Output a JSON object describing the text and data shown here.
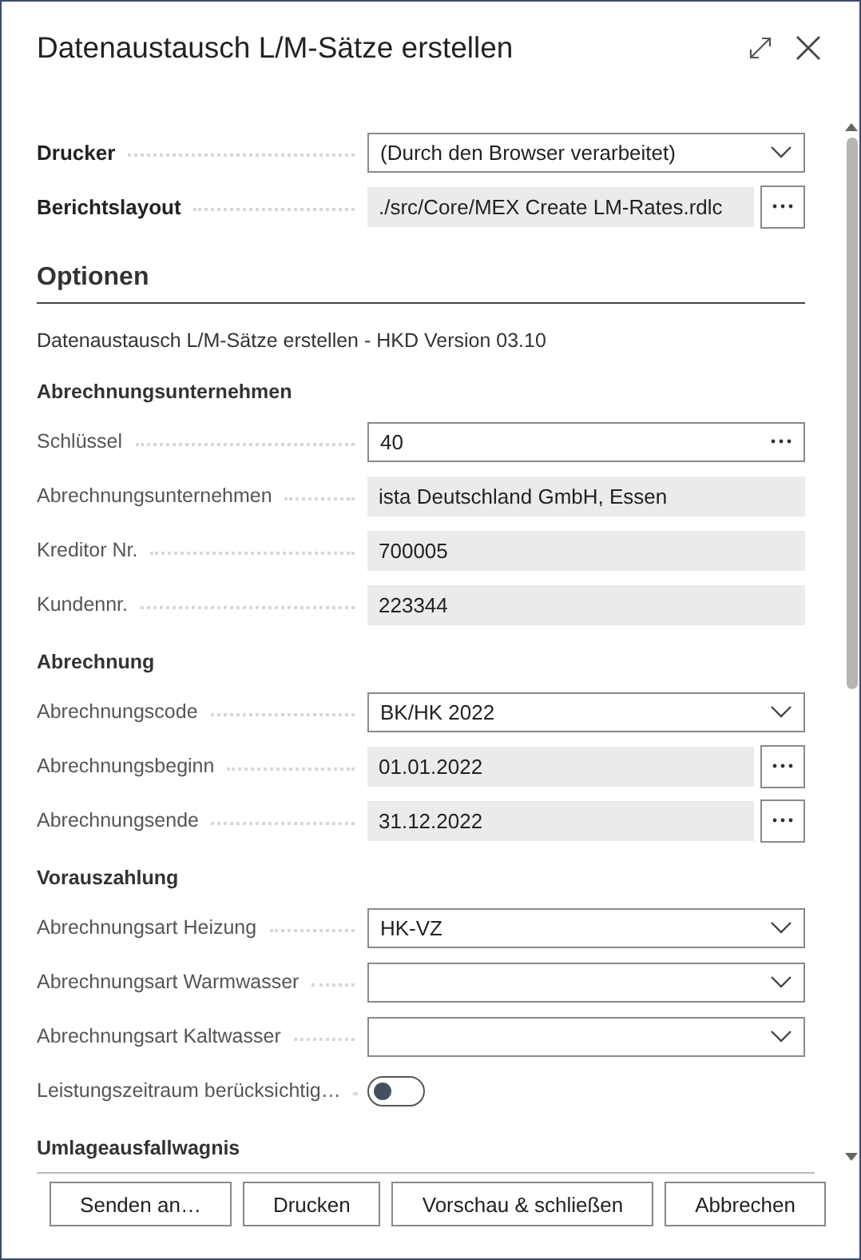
{
  "dialog": {
    "title": "Datenaustausch L/M-Sätze erstellen"
  },
  "report": {
    "fields": [
      {
        "label": "Drucker",
        "kind": "select",
        "value": "(Durch den Browser verarbeitet)"
      },
      {
        "label": "Berichtslayout",
        "kind": "readonly-assist",
        "value": "./src/Core/MEX Create LM-Rates.rdlc"
      }
    ]
  },
  "options": {
    "heading": "Optionen",
    "description": "Datenaustausch L/M-Sätze erstellen - HKD Version 03.10",
    "groups": [
      {
        "heading": "Abrechnungsunternehmen",
        "fields": [
          {
            "label": "Schlüssel",
            "kind": "lookup",
            "value": "40"
          },
          {
            "label": "Abrechnungsunternehmen",
            "kind": "readonly",
            "value": "ista Deutschland GmbH, Essen"
          },
          {
            "label": "Kreditor Nr.",
            "kind": "readonly",
            "value": "700005"
          },
          {
            "label": "Kundennr.",
            "kind": "readonly",
            "value": "223344"
          }
        ]
      },
      {
        "heading": "Abrechnung",
        "fields": [
          {
            "label": "Abrechnungscode",
            "kind": "select",
            "value": "BK/HK 2022"
          },
          {
            "label": "Abrechnungsbeginn",
            "kind": "readonly-assist",
            "value": "01.01.2022"
          },
          {
            "label": "Abrechnungsende",
            "kind": "readonly-assist",
            "value": "31.12.2022"
          }
        ]
      },
      {
        "heading": "Vorauszahlung",
        "fields": [
          {
            "label": "Abrechnungsart Heizung",
            "kind": "select",
            "value": "HK-VZ"
          },
          {
            "label": "Abrechnungsart Warmwasser",
            "kind": "select"
          },
          {
            "label": "Abrechnungsart Kaltwasser",
            "kind": "select"
          },
          {
            "label": "Leistungszeitraum berücksichtig…",
            "kind": "toggle",
            "on": false
          }
        ]
      },
      {
        "heading": "Umlageausfallwagnis"
      }
    ]
  },
  "buttons": [
    "Senden an…",
    "Drucken",
    "Vorschau & schließen",
    "Abbrechen"
  ]
}
